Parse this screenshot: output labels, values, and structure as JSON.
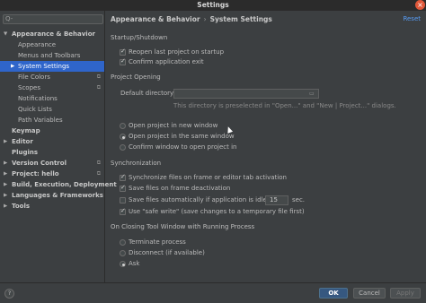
{
  "window": {
    "title": "Settings"
  },
  "search": {
    "placeholder": "",
    "glyph": "Q-"
  },
  "sidebar": {
    "items": [
      {
        "label": "Appearance & Behavior",
        "level": 0,
        "bold": true,
        "expanded": true
      },
      {
        "label": "Appearance",
        "level": 1
      },
      {
        "label": "Menus and Toolbars",
        "level": 1
      },
      {
        "label": "System Settings",
        "level": 1,
        "selected": true,
        "collapsed": true
      },
      {
        "label": "File Colors",
        "level": 1,
        "project": true
      },
      {
        "label": "Scopes",
        "level": 1,
        "project": true
      },
      {
        "label": "Notifications",
        "level": 1
      },
      {
        "label": "Quick Lists",
        "level": 1
      },
      {
        "label": "Path Variables",
        "level": 1
      },
      {
        "label": "Keymap",
        "level": 0,
        "bold": true,
        "leaf": true
      },
      {
        "label": "Editor",
        "level": 0,
        "bold": true
      },
      {
        "label": "Plugins",
        "level": 0,
        "bold": true,
        "leaf": true
      },
      {
        "label": "Version Control",
        "level": 0,
        "bold": true,
        "project": true
      },
      {
        "label": "Project: hello",
        "level": 0,
        "bold": true,
        "project": true
      },
      {
        "label": "Build, Execution, Deployment",
        "level": 0,
        "bold": true
      },
      {
        "label": "Languages & Frameworks",
        "level": 0,
        "bold": true
      },
      {
        "label": "Tools",
        "level": 0,
        "bold": true
      }
    ]
  },
  "breadcrumb": {
    "parent": "Appearance & Behavior",
    "separator": "›",
    "current": "System Settings"
  },
  "reset_label": "Reset",
  "startup": {
    "title": "Startup/Shutdown",
    "reopen": {
      "label": "Reopen last project on startup",
      "checked": true
    },
    "confirm_exit": {
      "label": "Confirm application exit",
      "checked": true
    }
  },
  "project_opening": {
    "title": "Project Opening",
    "default_dir_label": "Default directory:",
    "default_dir_value": "",
    "hint": "This directory is preselected in \"Open...\" and \"New | Project...\" dialogs.",
    "options": [
      {
        "label": "Open project in new window",
        "selected": false
      },
      {
        "label": "Open project in the same window",
        "selected": true
      },
      {
        "label": "Confirm window to open project in",
        "selected": false
      }
    ]
  },
  "sync": {
    "title": "Synchronization",
    "sync_files": {
      "label": "Synchronize files on frame or editor tab activation",
      "checked": true
    },
    "save_deact": {
      "label": "Save files on frame deactivation",
      "checked": true
    },
    "save_idle": {
      "label": "Save files automatically if application is idle for",
      "checked": false,
      "value": "15",
      "unit": "sec."
    },
    "safe_write": {
      "label": "Use \"safe write\" (save changes to a temporary file first)",
      "checked": true
    }
  },
  "closing": {
    "title": "On Closing Tool Window with Running Process",
    "options": [
      {
        "label": "Terminate process",
        "selected": false
      },
      {
        "label": "Disconnect (if available)",
        "selected": false
      },
      {
        "label": "Ask",
        "selected": true
      }
    ]
  },
  "buttons": {
    "help": "?",
    "ok": "OK",
    "cancel": "Cancel",
    "apply": "Apply"
  },
  "colors": {
    "accent": "#2f65ca",
    "primary_button": "#365880",
    "link": "#589df6",
    "close": "#e0583a"
  }
}
